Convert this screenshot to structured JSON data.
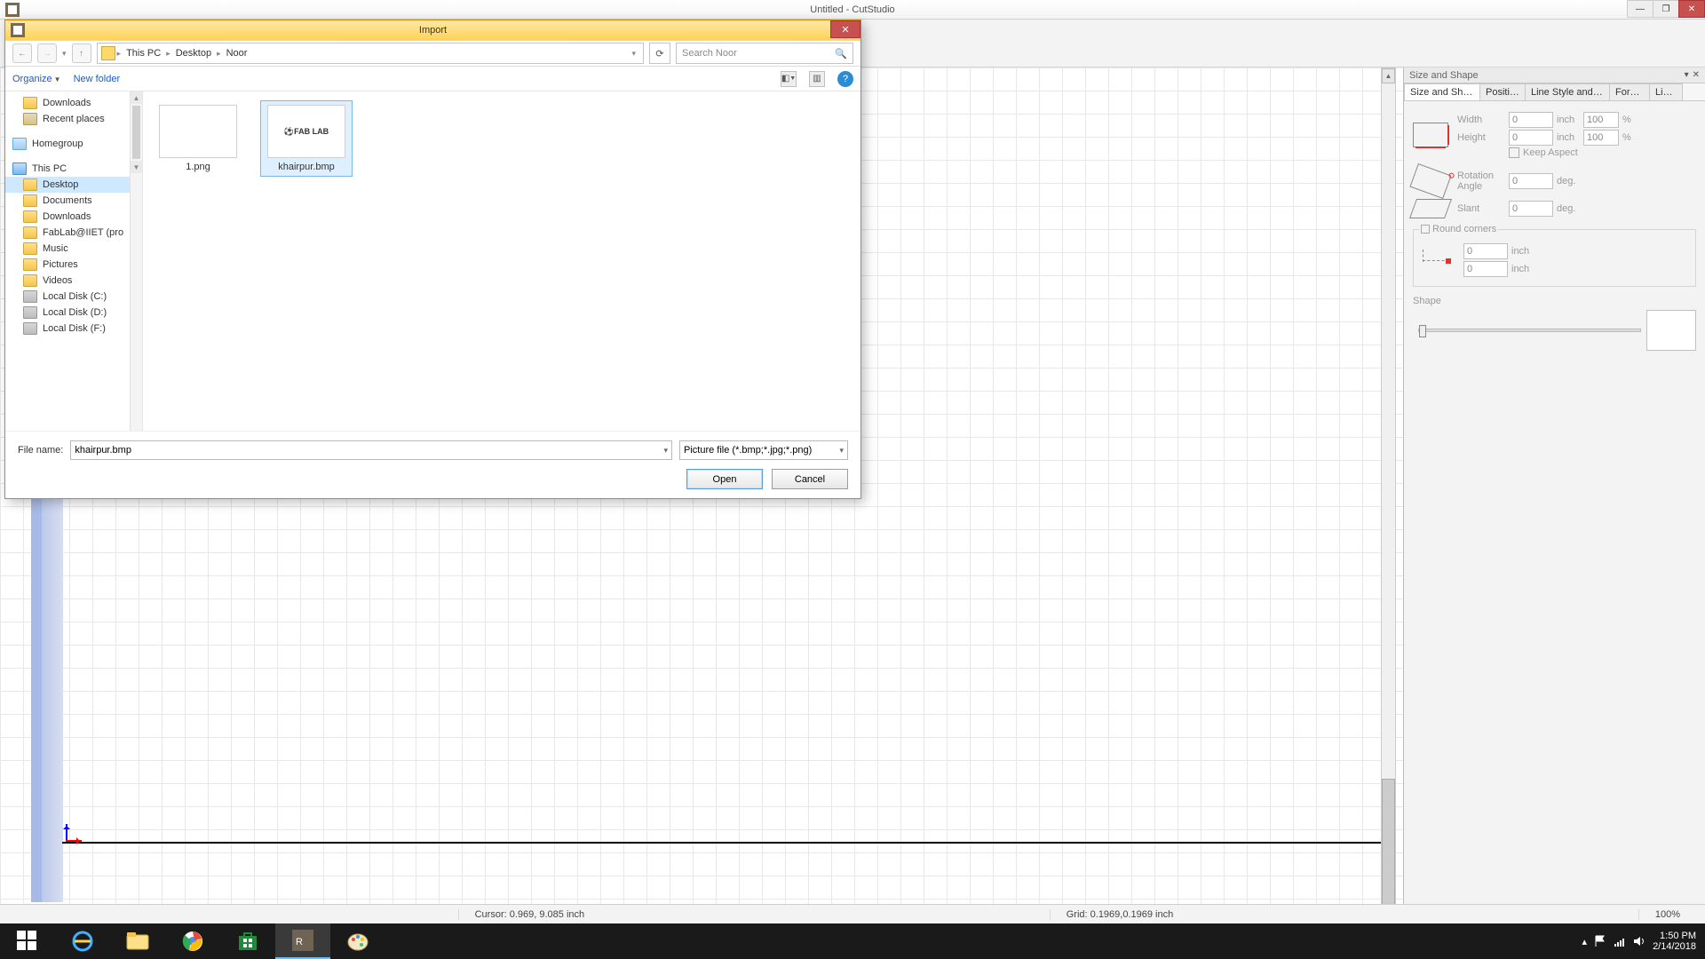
{
  "app": {
    "title": "Untitled - CutStudio",
    "win": {
      "min": "—",
      "max": "❐",
      "close": "✕"
    }
  },
  "panel": {
    "title": "Size and Shape",
    "tabs": [
      "Size and Shape",
      "Position",
      "Line Style and C...",
      "Format",
      "Links"
    ],
    "width_label": "Width",
    "width_val": "0",
    "width_unit": "inch",
    "width_pct": "100",
    "pct": "%",
    "height_label": "Height",
    "height_val": "0",
    "height_unit": "inch",
    "height_pct": "100",
    "keep_aspect": "Keep Aspect",
    "rotation_label": "Rotation Angle",
    "rotation_val": "0",
    "deg": "deg.",
    "slant_label": "Slant",
    "slant_val": "0",
    "round_label": "Round corners",
    "rc1": "0",
    "rc2": "0",
    "rc_unit": "inch",
    "shape_label": "Shape"
  },
  "status": {
    "cursor": "Cursor: 0.969, 9.085 inch",
    "grid": "Grid: 0.1969,0.1969 inch",
    "zoom": "100%"
  },
  "dialog": {
    "title": "Import",
    "nav": {
      "back": "←",
      "fwd": "→",
      "up": "↑"
    },
    "crumbs": [
      "This PC",
      "Desktop",
      "Noor"
    ],
    "search_placeholder": "Search Noor",
    "organize": "Organize",
    "new_folder": "New folder",
    "tree": {
      "downloads": "Downloads",
      "recent": "Recent places",
      "homegroup": "Homegroup",
      "this_pc": "This PC",
      "desktop": "Desktop",
      "documents": "Documents",
      "downloads2": "Downloads",
      "fablab": "FabLab@IIET (pro",
      "music": "Music",
      "pictures": "Pictures",
      "videos": "Videos",
      "c": "Local Disk (C:)",
      "d": "Local Disk (D:)",
      "f": "Local Disk (F:)"
    },
    "files": [
      {
        "name": "1.png",
        "thumb": ""
      },
      {
        "name": "khairpur.bmp",
        "thumb": "⚽FAB LAB"
      }
    ],
    "filename_label": "File name:",
    "filename_value": "khairpur.bmp",
    "filetype": "Picture file (*.bmp;*.jpg;*.png)",
    "open": "Open",
    "cancel": "Cancel"
  },
  "taskbar": {
    "time": "1:50 PM",
    "date": "2/14/2018"
  }
}
